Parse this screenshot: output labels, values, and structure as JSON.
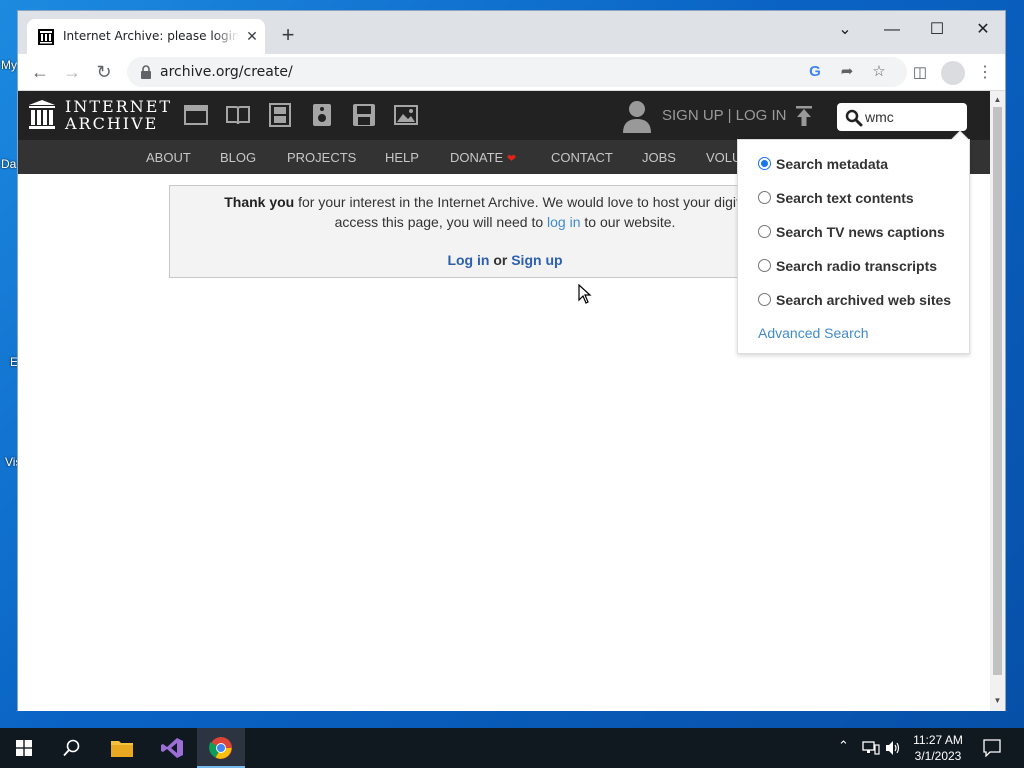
{
  "desktop": {
    "fragments": [
      "My",
      "Da",
      "E",
      "Vis"
    ]
  },
  "browser": {
    "tab_title": "Internet Archive: please login or sign up",
    "tab_close": "✕",
    "new_tab": "+",
    "url": "archive.org/create/",
    "window_controls": {
      "minimize": "—",
      "maximize": "☐",
      "close": "✕",
      "menu": "⌄"
    }
  },
  "ia": {
    "logo_line1": "INTERNET",
    "logo_line2": "ARCHIVE",
    "media_icons": [
      "web-icon",
      "texts-icon",
      "video-icon",
      "audio-icon",
      "software-icon",
      "images-icon"
    ],
    "signup_login": "SIGN UP | LOG IN",
    "search_value": "wmc",
    "nav": [
      "ABOUT",
      "BLOG",
      "PROJECTS",
      "HELP",
      "DONATE",
      "CONTACT",
      "JOBS",
      "VOLU"
    ],
    "notice": {
      "line1_bold": "Thank you",
      "line1_rest": " for your interest in the Internet Archive. We would love to host your digital artifa",
      "line2_pre": "access this page, you will need to ",
      "line2_link": "log in",
      "line2_post": " to our website.",
      "login_link": "Log in",
      "or": " or ",
      "signup_link": "Sign up"
    },
    "search_options": [
      {
        "label": "Search metadata",
        "selected": true
      },
      {
        "label": "Search text contents",
        "selected": false
      },
      {
        "label": "Search TV news captions",
        "selected": false
      },
      {
        "label": "Search radio transcripts",
        "selected": false
      },
      {
        "label": "Search archived web sites",
        "selected": false
      }
    ],
    "advanced_search": "Advanced Search"
  },
  "taskbar": {
    "time": "11:27 AM",
    "date": "3/1/2023"
  },
  "colors": {
    "ia_header": "#222222",
    "ia_nav": "#333333",
    "link": "#428bca",
    "radio_selected": "#1a73e8"
  }
}
